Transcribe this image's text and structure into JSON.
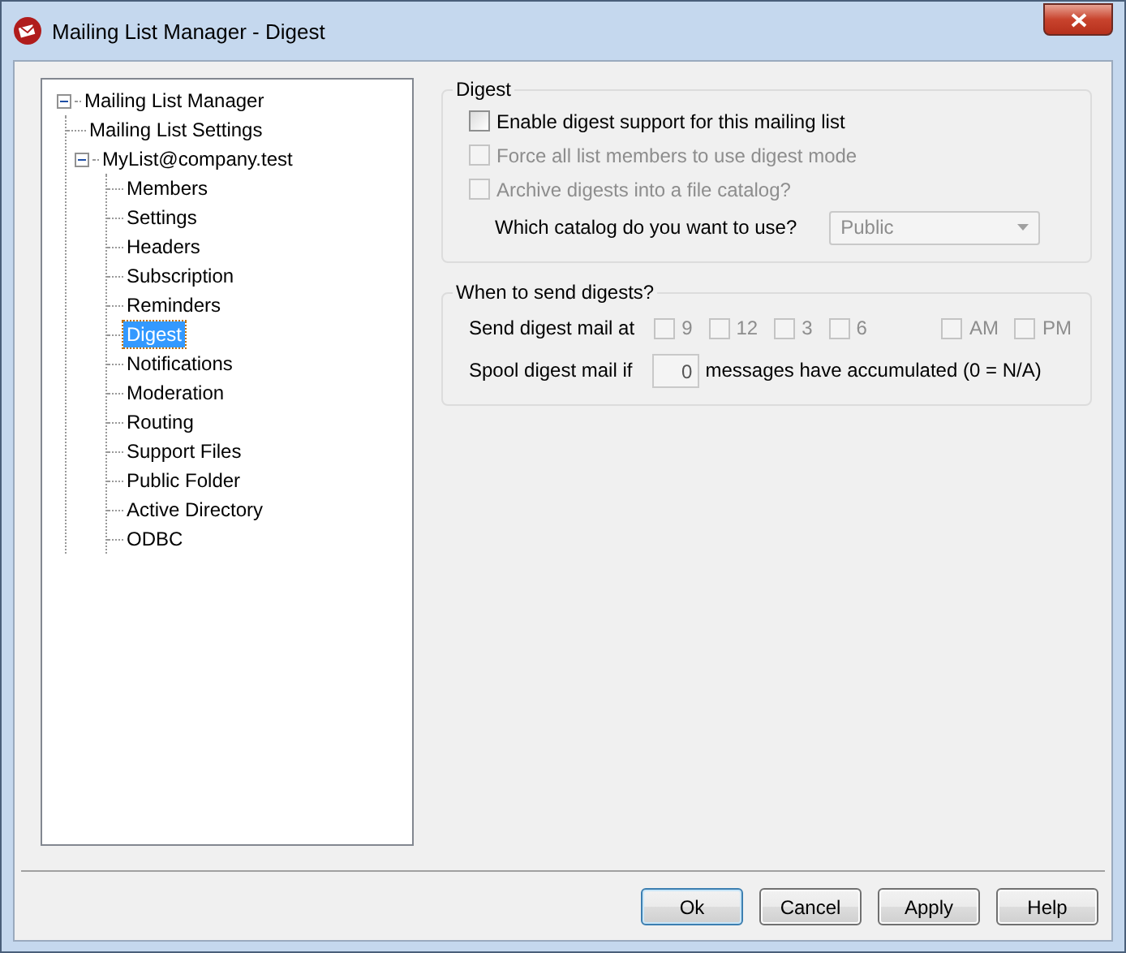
{
  "window": {
    "title": "Mailing List Manager - Digest"
  },
  "tree": [
    {
      "label": "Mailing List Manager",
      "expanded": true,
      "selected": false,
      "children": [
        {
          "label": "Mailing List Settings",
          "selected": false
        },
        {
          "label": "MyList@company.test",
          "expanded": true,
          "selected": false,
          "children": [
            {
              "label": "Members",
              "selected": false
            },
            {
              "label": "Settings",
              "selected": false
            },
            {
              "label": "Headers",
              "selected": false
            },
            {
              "label": "Subscription",
              "selected": false
            },
            {
              "label": "Reminders",
              "selected": false
            },
            {
              "label": "Digest",
              "selected": true
            },
            {
              "label": "Notifications",
              "selected": false
            },
            {
              "label": "Moderation",
              "selected": false
            },
            {
              "label": "Routing",
              "selected": false
            },
            {
              "label": "Support Files",
              "selected": false
            },
            {
              "label": "Public Folder",
              "selected": false
            },
            {
              "label": "Active Directory",
              "selected": false
            },
            {
              "label": "ODBC",
              "selected": false
            }
          ]
        }
      ]
    }
  ],
  "digest_group": {
    "title": "Digest",
    "options": [
      {
        "label": "Enable digest support for this mailing list",
        "checked": false,
        "disabled": false
      },
      {
        "label": "Force all list members to use digest mode",
        "checked": false,
        "disabled": true
      },
      {
        "label": "Archive digests into a file catalog?",
        "checked": false,
        "disabled": true
      }
    ],
    "catalog": {
      "label": "Which catalog do you want to use?",
      "value": "Public",
      "disabled": true
    }
  },
  "schedule_group": {
    "title": "When to send digests?",
    "send_label": "Send digest mail at",
    "hours": [
      {
        "label": "9",
        "checked": false,
        "disabled": true
      },
      {
        "label": "12",
        "checked": false,
        "disabled": true
      },
      {
        "label": "3",
        "checked": false,
        "disabled": true
      },
      {
        "label": "6",
        "checked": false,
        "disabled": true
      }
    ],
    "periods": [
      {
        "label": "AM",
        "checked": false,
        "disabled": true
      },
      {
        "label": "PM",
        "checked": false,
        "disabled": true
      }
    ],
    "spool_label": "Spool digest mail if",
    "spool_value": "0",
    "spool_suffix": "messages have accumulated (0 = N/A)"
  },
  "buttons": [
    {
      "label": "Ok",
      "default": true
    },
    {
      "label": "Cancel",
      "default": false
    },
    {
      "label": "Apply",
      "default": false
    },
    {
      "label": "Help",
      "default": false
    }
  ]
}
